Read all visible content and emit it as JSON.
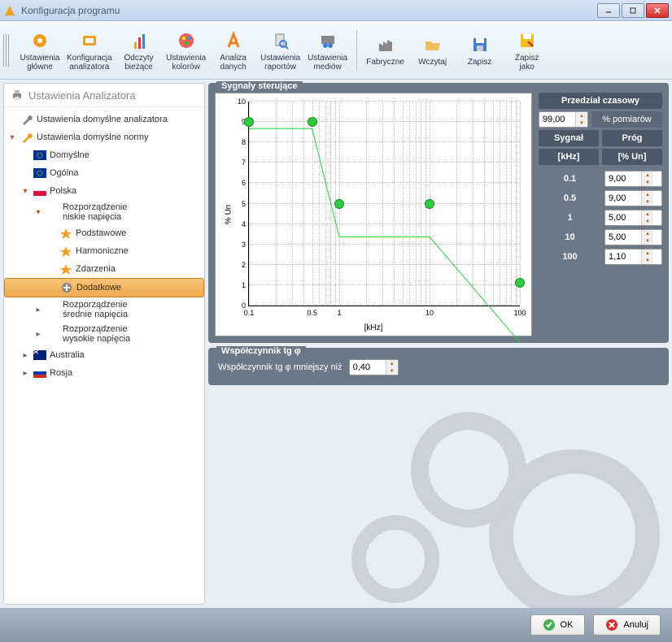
{
  "window": {
    "title": "Konfiguracja programu"
  },
  "toolbar": [
    {
      "id": "ust-glowne",
      "label": "Ustawienia\ngłówne",
      "icon": "gear-orange"
    },
    {
      "id": "konf-anal",
      "label": "Konfiguracja\nanalizatora",
      "icon": "screen-orange"
    },
    {
      "id": "odczyty",
      "label": "Odczyty\nbieżące",
      "icon": "bars-orange"
    },
    {
      "id": "ust-kolor",
      "label": "Ustawienia\nkolorów",
      "icon": "palette"
    },
    {
      "id": "analiza",
      "label": "Analiza\ndanych",
      "icon": "letter-a"
    },
    {
      "id": "ust-rap",
      "label": "Ustawienia\nraportów",
      "icon": "doc-search"
    },
    {
      "id": "ust-med",
      "label": "Ustawienia\nmediów",
      "icon": "media"
    },
    {
      "sep": true
    },
    {
      "id": "fabr",
      "label": "Fabryczne",
      "icon": "factory"
    },
    {
      "id": "wczytaj",
      "label": "Wczytaj",
      "icon": "folder-open"
    },
    {
      "id": "zapisz",
      "label": "Zapisz",
      "icon": "disk"
    },
    {
      "id": "zapisz-jako",
      "label": "Zapisz\njako",
      "icon": "disk-pencil"
    }
  ],
  "sidebar": {
    "header": "Ustawienia Analizatora",
    "items": [
      {
        "indent": 0,
        "exp": "",
        "icon": "wrench",
        "label": "Ustawienia domyślne analizatora"
      },
      {
        "indent": 0,
        "exp": "down",
        "icon": "wrench-orange",
        "label": "Ustawienia domyślne normy"
      },
      {
        "indent": 1,
        "exp": "",
        "icon": "flag-eu",
        "label": "Domyślne"
      },
      {
        "indent": 1,
        "exp": "",
        "icon": "flag-eu",
        "label": "Ogólna"
      },
      {
        "indent": 1,
        "exp": "down",
        "icon": "flag-pl",
        "label": "Polska"
      },
      {
        "indent": 2,
        "exp": "down",
        "icon": "",
        "label": "Rozporządzenie\nniskie napięcia"
      },
      {
        "indent": 3,
        "exp": "",
        "icon": "star",
        "label": "Podstawowe"
      },
      {
        "indent": 3,
        "exp": "",
        "icon": "star",
        "label": "Harmoniczne"
      },
      {
        "indent": 3,
        "exp": "",
        "icon": "star",
        "label": "Zdarzenia"
      },
      {
        "indent": 3,
        "exp": "",
        "icon": "plus",
        "label": "Dodatkowe",
        "selected": true
      },
      {
        "indent": 2,
        "exp": "right",
        "icon": "",
        "label": "Rozporządzenie\nśrednie napięcia"
      },
      {
        "indent": 2,
        "exp": "right",
        "icon": "",
        "label": "Rozporządzenie\nwysokie napięcia"
      },
      {
        "indent": 1,
        "exp": "right",
        "icon": "flag-au",
        "label": "Australia"
      },
      {
        "indent": 1,
        "exp": "right",
        "icon": "flag-ru",
        "label": "Rosja"
      }
    ]
  },
  "group_signals": {
    "title": "Sygnały sterujące",
    "ylabel": "% Un",
    "xlabel": "[kHz]",
    "time_header": "Przedział czasowy",
    "percent_value": "99,00",
    "percent_label": "% pomiarów",
    "col_signal": "Sygnał",
    "col_prog": "Próg",
    "col_khz": "[kHz]",
    "col_un": "[% Un]",
    "rows": [
      {
        "khz": "0.1",
        "un": "9,00"
      },
      {
        "khz": "0.5",
        "un": "9,00"
      },
      {
        "khz": "1",
        "un": "5,00"
      },
      {
        "khz": "10",
        "un": "5,00"
      },
      {
        "khz": "100",
        "un": "1,10"
      }
    ]
  },
  "chart_data": {
    "type": "line",
    "xscale": "log",
    "x": [
      0.1,
      0.5,
      1,
      10,
      100
    ],
    "y": [
      9,
      9,
      5,
      5,
      1.1
    ],
    "xlabel": "[kHz]",
    "ylabel": "% Un",
    "xlim": [
      0.1,
      100
    ],
    "ylim": [
      0,
      10
    ],
    "xticks": [
      0.1,
      0.5,
      1,
      10,
      100
    ],
    "yticks": [
      0,
      1,
      2,
      3,
      4,
      5,
      6,
      7,
      8,
      9,
      10
    ]
  },
  "group_tg": {
    "title": "Współczynnik tg φ",
    "label": "Współczynnik tg φ mniejszy niż",
    "value": "0,40"
  },
  "footer": {
    "ok": "OK",
    "cancel": "Anuluj"
  }
}
